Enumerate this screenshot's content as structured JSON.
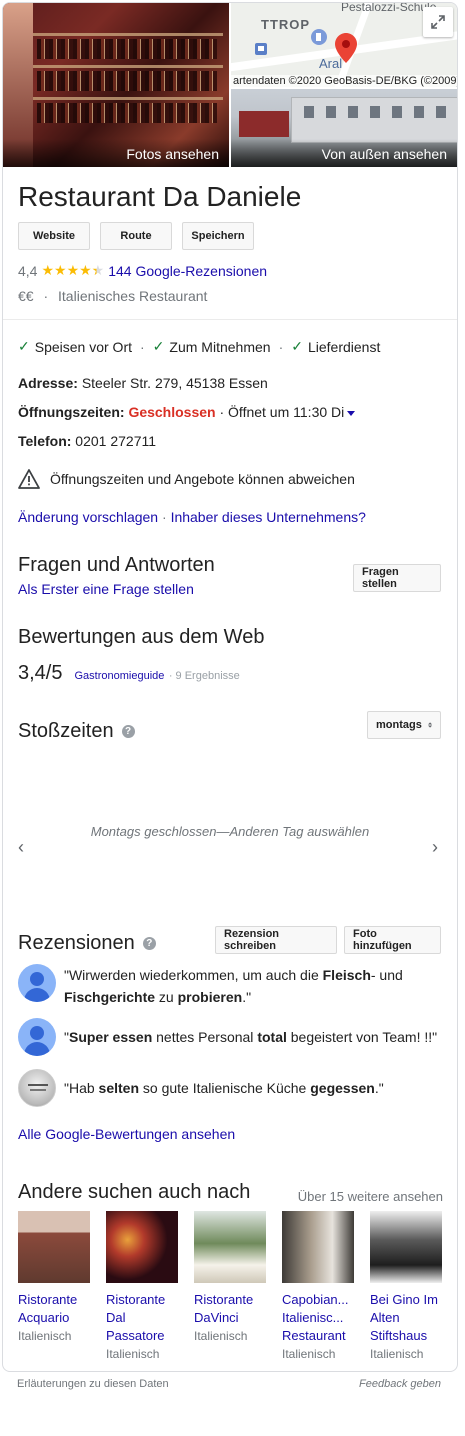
{
  "hero": {
    "photos_label": "Fotos ansehen",
    "exterior_label": "Von außen ansehen",
    "map_place_top": "Pestalozzi-Schule",
    "map_area": "TTROP",
    "map_station": "Aral",
    "map_credit": "artendaten ©2020 GeoBasis-DE/BKG (©2009)"
  },
  "business": {
    "name": "Restaurant Da Daniele",
    "buttons": [
      "Website",
      "Route",
      "Speichern"
    ],
    "rating": "4,4",
    "stars": "★★★★★",
    "reviews_link": "144 Google-Rezensionen",
    "price": "€€",
    "dot": "·",
    "category": "Italienisches Restaurant"
  },
  "services": [
    {
      "label": "Speisen vor Ort"
    },
    {
      "label": "Zum Mitnehmen"
    },
    {
      "label": "Lieferdienst"
    }
  ],
  "details": {
    "address_label": "Adresse:",
    "address_value": "Steeler Str. 279, 45138 Essen",
    "hours_label": "Öffnungszeiten:",
    "hours_status": "Geschlossen",
    "hours_next": "· Öffnet um 11:30 Di",
    "phone_label": "Telefon:",
    "phone_value": "0201 272711",
    "warning": "Öffnungszeiten und Angebote können abweichen",
    "suggest_edit": "Änderung vorschlagen",
    "suggest_sep": "·",
    "owner": "Inhaber dieses Unternehmens?"
  },
  "qa": {
    "title": "Fragen und Antworten",
    "link": "Als Erster eine Frage stellen",
    "button": "Fragen stellen"
  },
  "web_reviews": {
    "title": "Bewertungen aus dem Web",
    "score": "3,4/5",
    "source": "Gastronomieguide",
    "count": "· 9 Ergebnisse"
  },
  "popular_times": {
    "title": "Stoßzeiten",
    "day_selector": "montags",
    "message": "Montags geschlossen—Anderen Tag auswählen",
    "prev": "‹",
    "next": "›"
  },
  "reviews": {
    "title": "Rezensionen",
    "write_button": "Rezension schreiben",
    "photo_button": "Foto hinzufügen",
    "items": [
      {
        "html": "\"Wirwerden wiederkommen, um auch die <b>Fleisch</b>- und <b>Fischgerichte</b> zu <b>probieren</b>.\""
      },
      {
        "html": "\"<b>Super essen</b> nettes Personal <b>total</b> begeistert von Team! !!\""
      },
      {
        "html": "\"Hab <b>selten</b> so gute Italienische Küche <b>gegessen</b>.\""
      }
    ],
    "all_link": "Alle Google-Bewertungen ansehen"
  },
  "others": {
    "title": "Andere suchen auch nach",
    "more": "Über 15 weitere ansehen",
    "items": [
      {
        "name": "Ristorante Acquario",
        "sub": "Italienisch",
        "colors": [
          "#8c4a3c",
          "#d9c1b3",
          "#5f3a2f"
        ]
      },
      {
        "name": "Ristorante Dal Passatore",
        "sub": "Italienisch",
        "colors": [
          "#2a0b12",
          "#b23a2b",
          "#e9a13b"
        ]
      },
      {
        "name": "Ristorante DaVinci",
        "sub": "Italienisch",
        "colors": [
          "#dfe6e2",
          "#6f8a5b",
          "#f5f2ea"
        ]
      },
      {
        "name": "Capobian... Italienisc... Restaurant",
        "sub": "Italienisch",
        "colors": [
          "#3d3a36",
          "#a99d8d",
          "#e7e3dd"
        ]
      },
      {
        "name": "Bei Gino Im Alten Stiftshaus",
        "sub": "Italienisch",
        "colors": [
          "#efefef",
          "#5a5a5a",
          "#1e1e1e"
        ]
      }
    ]
  },
  "footer": {
    "explain": "Erläuterungen zu diesen Daten",
    "feedback": "Feedback geben"
  },
  "colors": {
    "link": "#1a0dab",
    "closed": "#d93025",
    "star": "#fbbc04",
    "check": "#188038"
  },
  "icons": [
    "expand-icon",
    "map-pin-icon",
    "check-icon",
    "warning-icon",
    "help-icon",
    "caret-down-icon",
    "chevron-left-icon",
    "chevron-right-icon",
    "avatar-icon"
  ]
}
